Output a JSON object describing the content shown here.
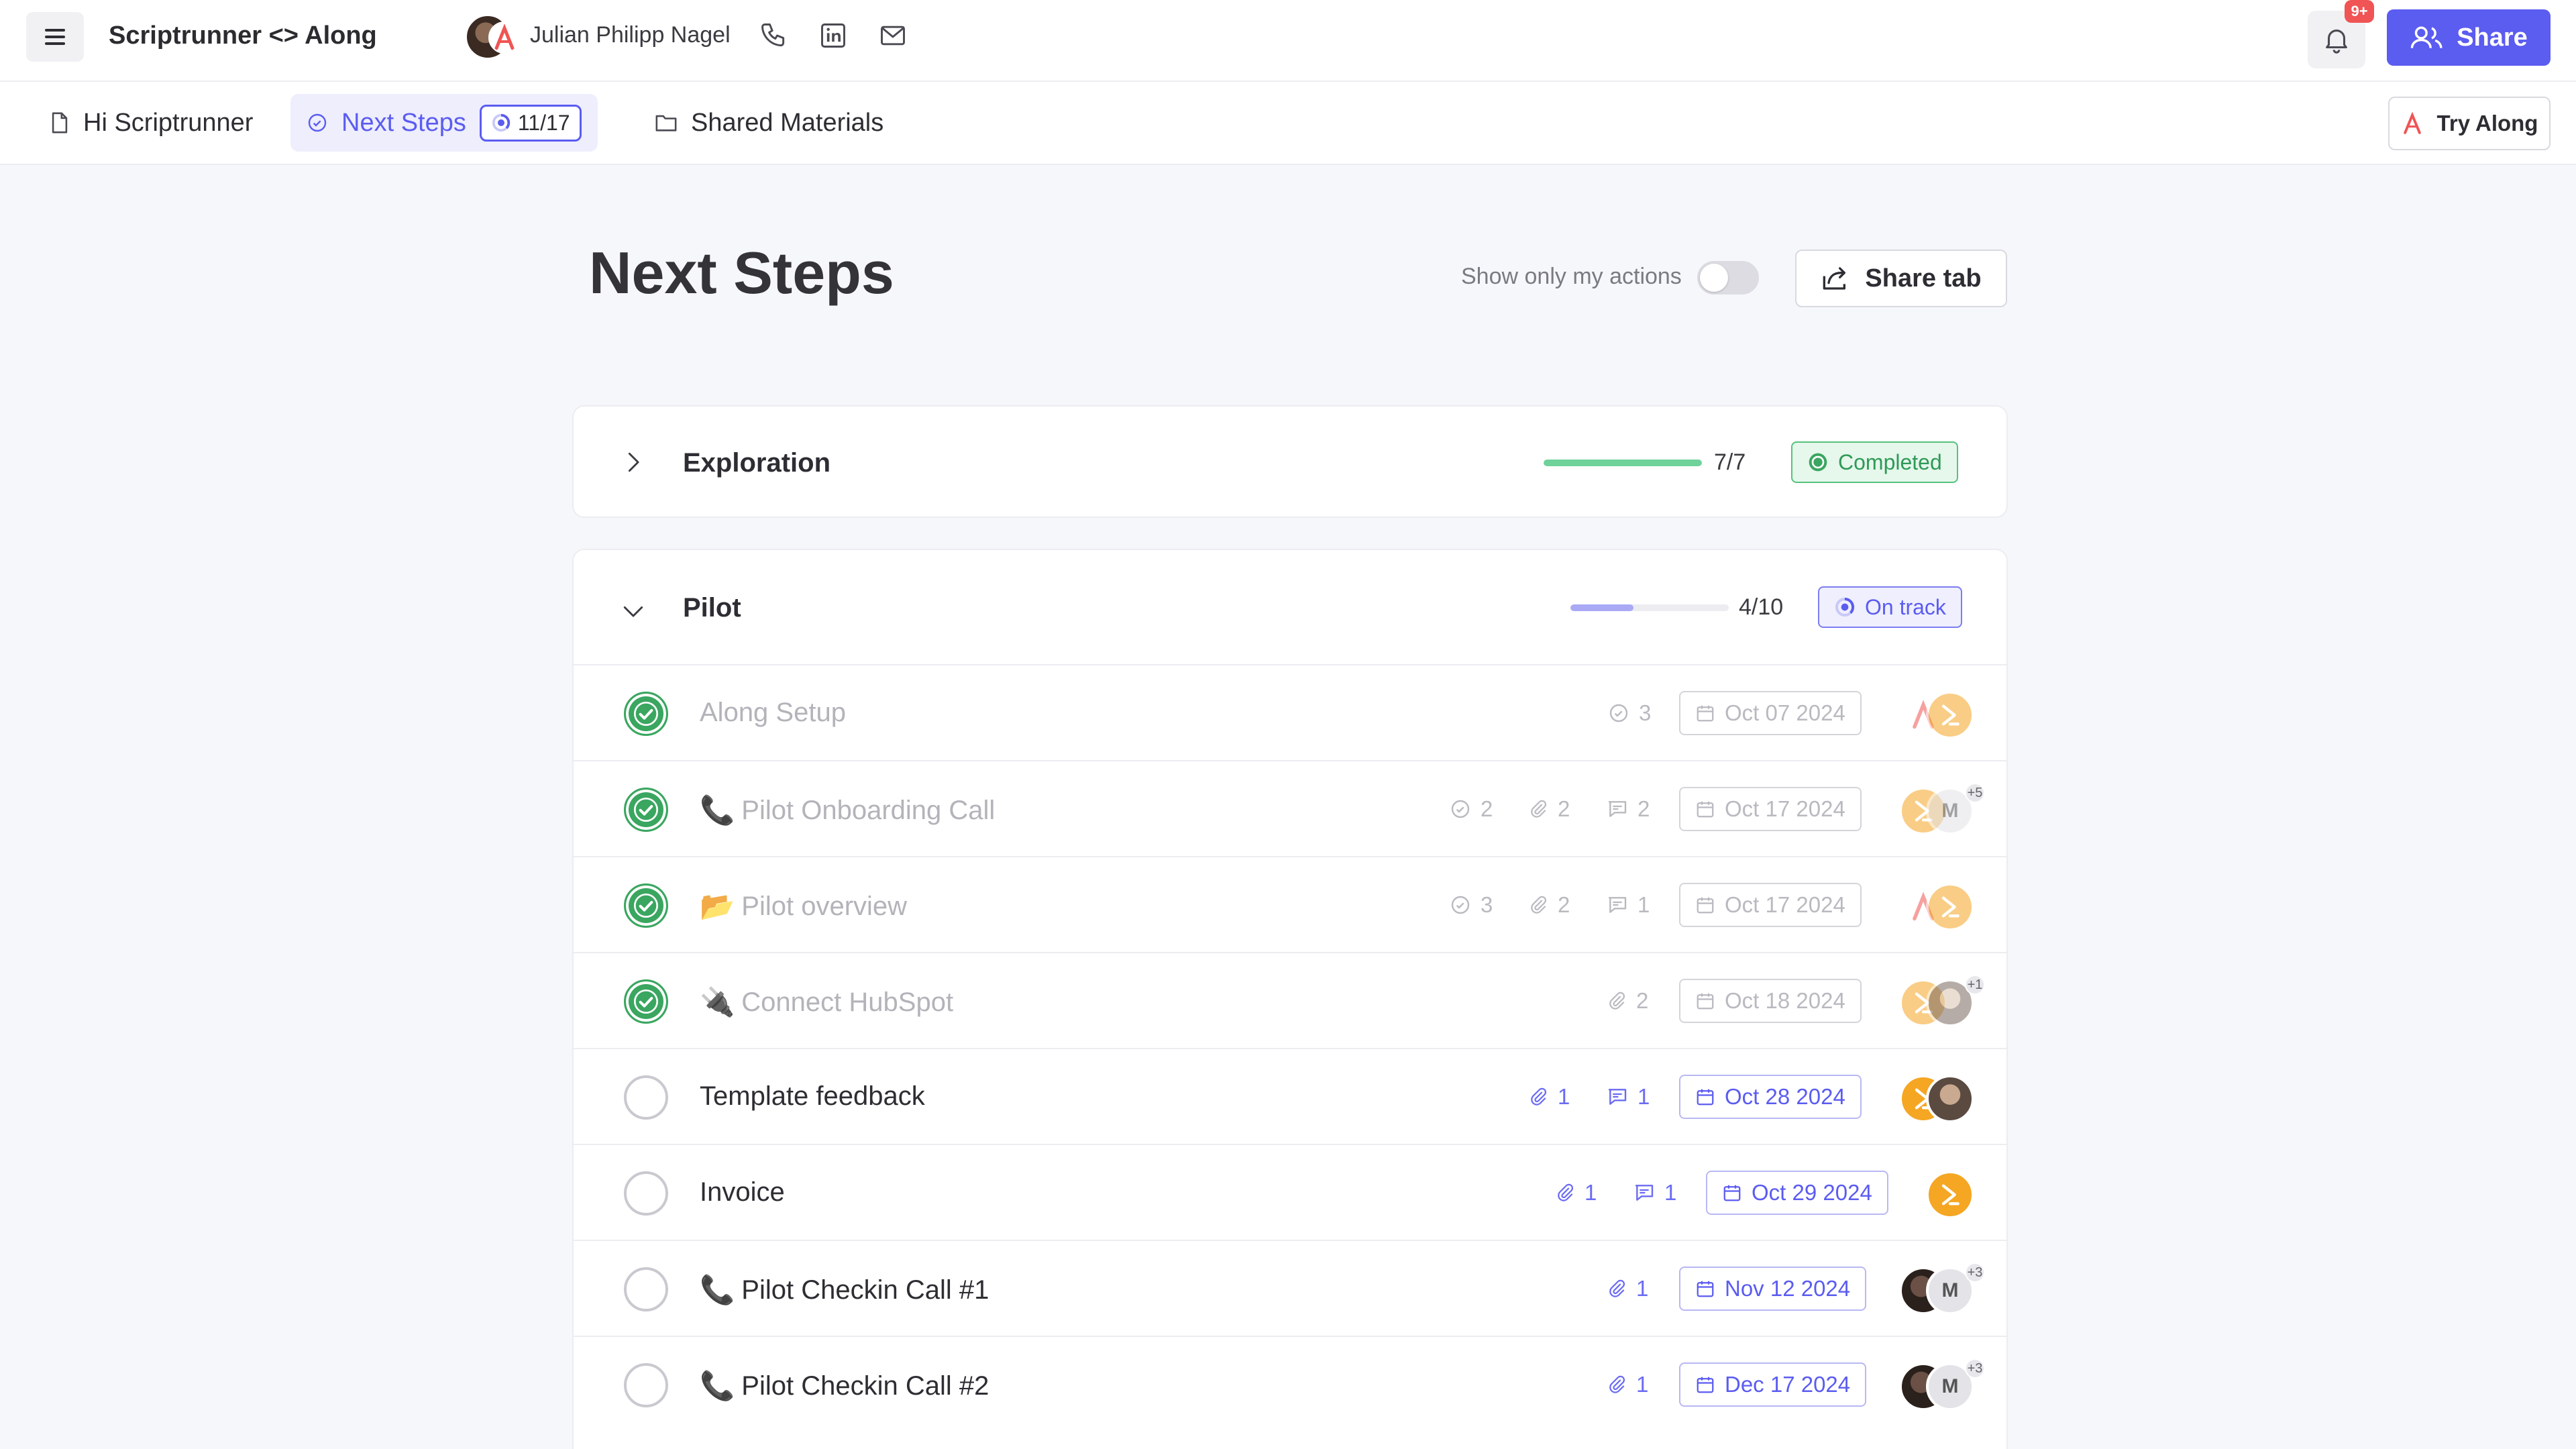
{
  "header": {
    "workspace_title": "Scriptrunner <> Along",
    "contact_name": "Julian Philipp Nagel",
    "notification_count": "9+",
    "share_label": "Share"
  },
  "tabs": [
    {
      "label": "Hi Scriptrunner",
      "icon": "document-icon"
    },
    {
      "label": "Next Steps",
      "icon": "check-circle-icon",
      "count": "11/17"
    },
    {
      "label": "Shared Materials",
      "icon": "folder-icon"
    }
  ],
  "try_along_label": "Try Along",
  "page": {
    "title": "Next Steps",
    "toggle_label": "Show only my actions",
    "toggle_on": false,
    "share_tab_label": "Share tab"
  },
  "colors": {
    "accent": "#5b5cf0",
    "success": "#3aa660",
    "muted": "#b3b3ba"
  },
  "sections": [
    {
      "title": "Exploration",
      "expanded": false,
      "count": "7/7",
      "progress": 1.0,
      "status": "Completed"
    },
    {
      "title": "Pilot",
      "expanded": true,
      "count": "4/10",
      "progress": 0.4,
      "status": "On track",
      "tasks": [
        {
          "title": "Along Setup",
          "emoji": "",
          "done": true,
          "subtasks": "3",
          "attachments": "",
          "comments": "",
          "due": "Oct 07 2024",
          "more": ""
        },
        {
          "title": "Pilot Onboarding Call",
          "emoji": "📞",
          "done": true,
          "subtasks": "2",
          "attachments": "2",
          "comments": "2",
          "due": "Oct 17 2024",
          "more": "+5"
        },
        {
          "title": "Pilot overview",
          "emoji": "📂",
          "done": true,
          "subtasks": "3",
          "attachments": "2",
          "comments": "1",
          "due": "Oct 17 2024",
          "more": ""
        },
        {
          "title": "Connect HubSpot",
          "emoji": "🔌",
          "done": true,
          "subtasks": "",
          "attachments": "2",
          "comments": "",
          "due": "Oct 18 2024",
          "more": "+1"
        },
        {
          "title": "Template feedback",
          "emoji": "",
          "done": false,
          "subtasks": "",
          "attachments": "1",
          "comments": "1",
          "due": "Oct 28 2024",
          "more": ""
        },
        {
          "title": "Invoice",
          "emoji": "",
          "done": false,
          "subtasks": "",
          "attachments": "1",
          "comments": "1",
          "due": "Oct 29 2024",
          "more": ""
        },
        {
          "title": "Pilot Checkin Call #1",
          "emoji": "📞",
          "done": false,
          "subtasks": "",
          "attachments": "1",
          "comments": "",
          "due": "Nov 12 2024",
          "more": "+3"
        },
        {
          "title": "Pilot Checkin Call #2",
          "emoji": "📞",
          "done": false,
          "subtasks": "",
          "attachments": "1",
          "comments": "",
          "due": "Dec 17 2024",
          "more": "+3"
        }
      ]
    }
  ],
  "assignee_initial": "M"
}
